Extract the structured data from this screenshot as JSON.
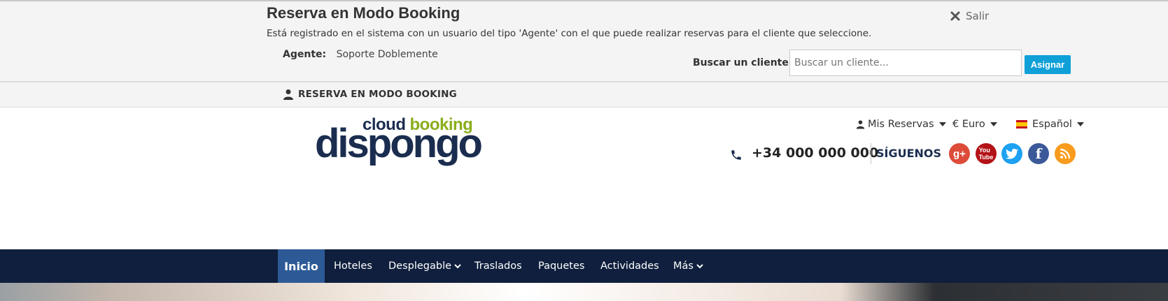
{
  "booking_panel": {
    "title": "Reserva en Modo Booking",
    "description": "Está registrado en el sistema con un usuario del tipo 'Agente' con el que puede realizar reservas para el cliente que seleccione.",
    "agent_label": "Agente:",
    "agent_value": "Soporte Doblemente",
    "exit_label": "Salir",
    "search_label": "Buscar un cliente:",
    "search_placeholder": "Buscar un cliente...",
    "assign_label": "Asignar"
  },
  "mode_strip": {
    "label": "RESERVA EN MODO BOOKING"
  },
  "header": {
    "logo_cloud": "cloud",
    "logo_booking": "booking",
    "logo_main": "dispongo",
    "my_bookings": "Mis Reservas",
    "currency": "€ Euro",
    "language": "Español",
    "phone": "+34 000 000 000",
    "follow_label": "SÍGUENOS",
    "social_icons": [
      "google-plus-icon",
      "youtube-icon",
      "twitter-icon",
      "facebook-icon",
      "rss-icon"
    ]
  },
  "main_nav": {
    "items": [
      {
        "label": "Inicio",
        "active": true
      },
      {
        "label": "Hoteles"
      },
      {
        "label": "Desplegable",
        "dropdown": true
      },
      {
        "label": "Traslados"
      },
      {
        "label": "Paquetes"
      },
      {
        "label": "Actividades"
      },
      {
        "label": "Más",
        "dropdown": true
      }
    ]
  },
  "colors": {
    "nav_background": "#0f1f3d",
    "nav_active": "#2d5a97",
    "assign_button": "#0fa0d8",
    "brand_dark": "#1b2d4f",
    "brand_green": "#8aae1b"
  }
}
